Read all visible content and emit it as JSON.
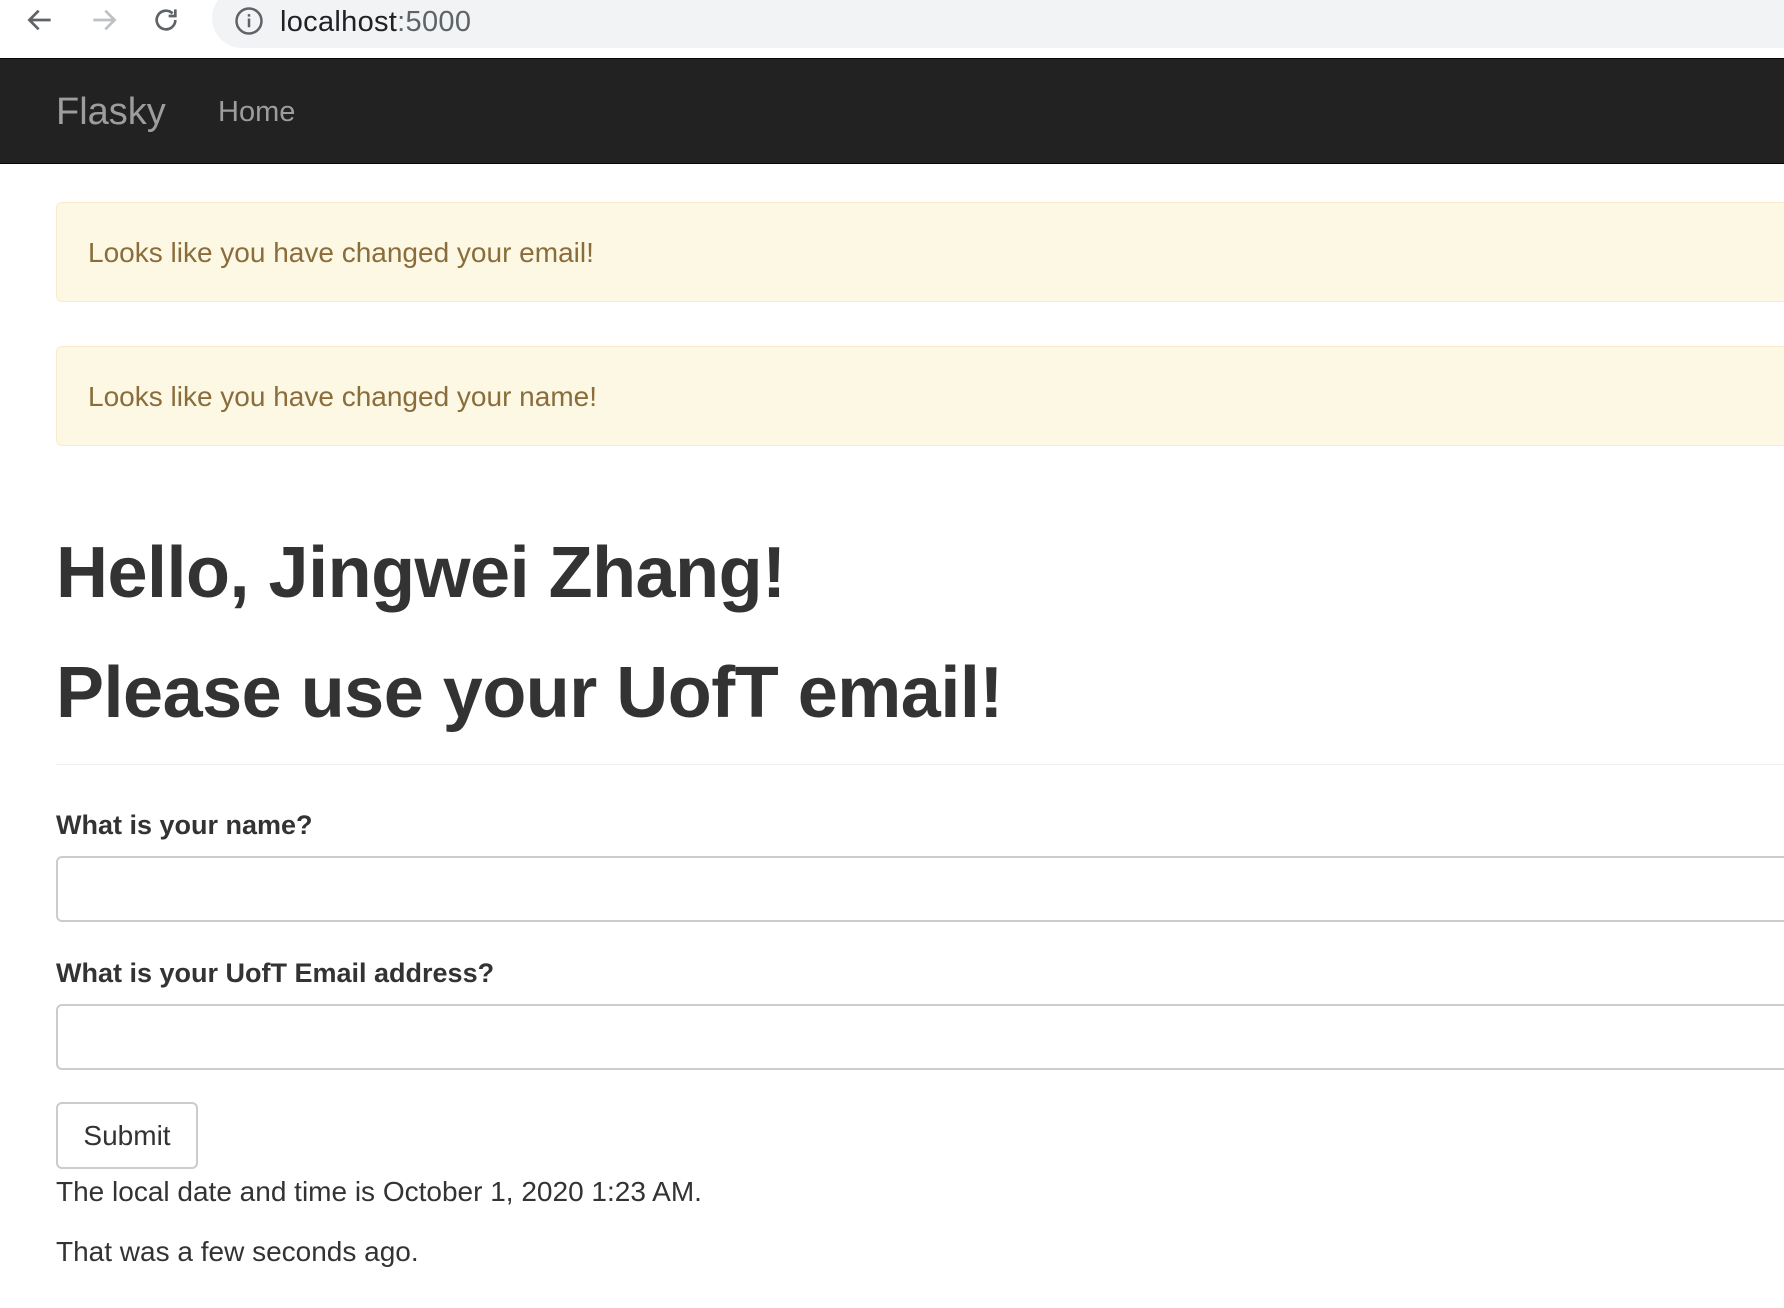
{
  "browser": {
    "url_host": "localhost",
    "url_port": ":5000"
  },
  "navbar": {
    "brand": "Flasky",
    "home": "Home"
  },
  "alerts": [
    {
      "message": "Looks like you have changed your email!"
    },
    {
      "message": "Looks like you have changed your name!"
    }
  ],
  "main": {
    "greeting": "Hello, Jingwei Zhang!",
    "notice": "Please use your UofT email!"
  },
  "form": {
    "name_label": "What is your name?",
    "name_value": "",
    "email_label": "What is your UofT Email address?",
    "email_value": "",
    "submit_label": "Submit"
  },
  "footer": {
    "datetime_text": "The local date and time is October 1, 2020 1:23 AM.",
    "relative_text": "That was a few seconds ago."
  },
  "colors": {
    "navbar_bg": "#222222",
    "alert_bg": "#fcf8e3",
    "alert_text": "#8a6d3b"
  }
}
